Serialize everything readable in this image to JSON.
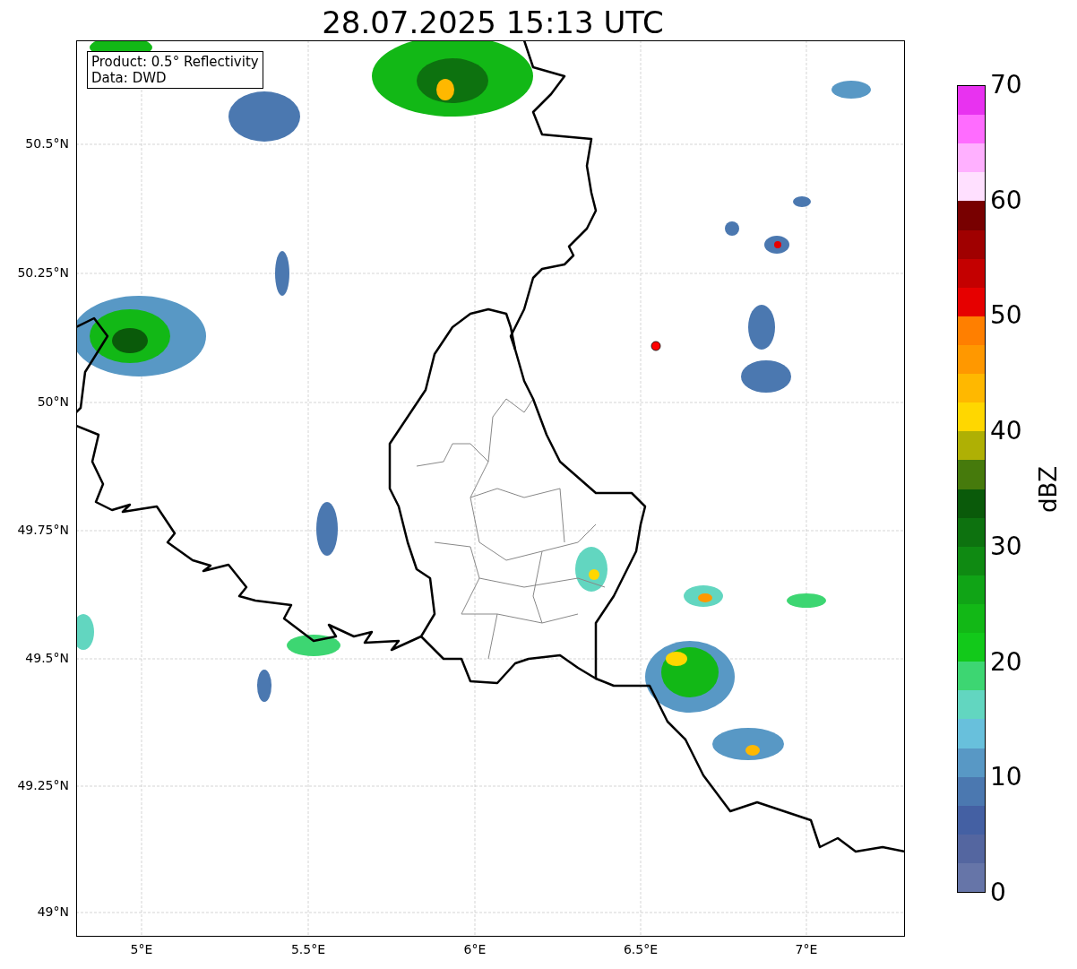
{
  "title": "28.07.2025 15:13 UTC",
  "info_box": [
    "Product: 0.5° Reflectivity",
    "Data: DWD"
  ],
  "map": {
    "yticks": [
      "50.5°N",
      "50.25°N",
      "50°N",
      "49.75°N",
      "49.5°N",
      "49.25°N",
      "49°N"
    ],
    "xticks": [
      "5°E",
      "5.5°E",
      "6°E",
      "6.5°E",
      "7°E"
    ]
  },
  "colorbar": {
    "label": "dBZ",
    "ticks": [
      "70",
      "60",
      "50",
      "40",
      "30",
      "20",
      "10",
      "0"
    ],
    "segments": [
      {
        "color": "#e832f0"
      },
      {
        "color": "#ff6cff"
      },
      {
        "color": "#ffb0ff"
      },
      {
        "color": "#ffe0ff"
      },
      {
        "color": "#780000"
      },
      {
        "color": "#a00000"
      },
      {
        "color": "#c40000"
      },
      {
        "color": "#e60000"
      },
      {
        "color": "#ff7f00"
      },
      {
        "color": "#ff9800"
      },
      {
        "color": "#ffb800"
      },
      {
        "color": "#ffd700"
      },
      {
        "color": "#afb004"
      },
      {
        "color": "#467a0c"
      },
      {
        "color": "#0a5a0a"
      },
      {
        "color": "#0d720f"
      },
      {
        "color": "#0f8a12"
      },
      {
        "color": "#10a416"
      },
      {
        "color": "#12b816"
      },
      {
        "color": "#12c91a"
      },
      {
        "color": "#3dd672"
      },
      {
        "color": "#62d6c0"
      },
      {
        "color": "#68c0dc"
      },
      {
        "color": "#5898c5"
      },
      {
        "color": "#4b78b0"
      },
      {
        "color": "#4460a3"
      },
      {
        "color": "#5466a0"
      },
      {
        "color": "#6675a8"
      }
    ]
  }
}
